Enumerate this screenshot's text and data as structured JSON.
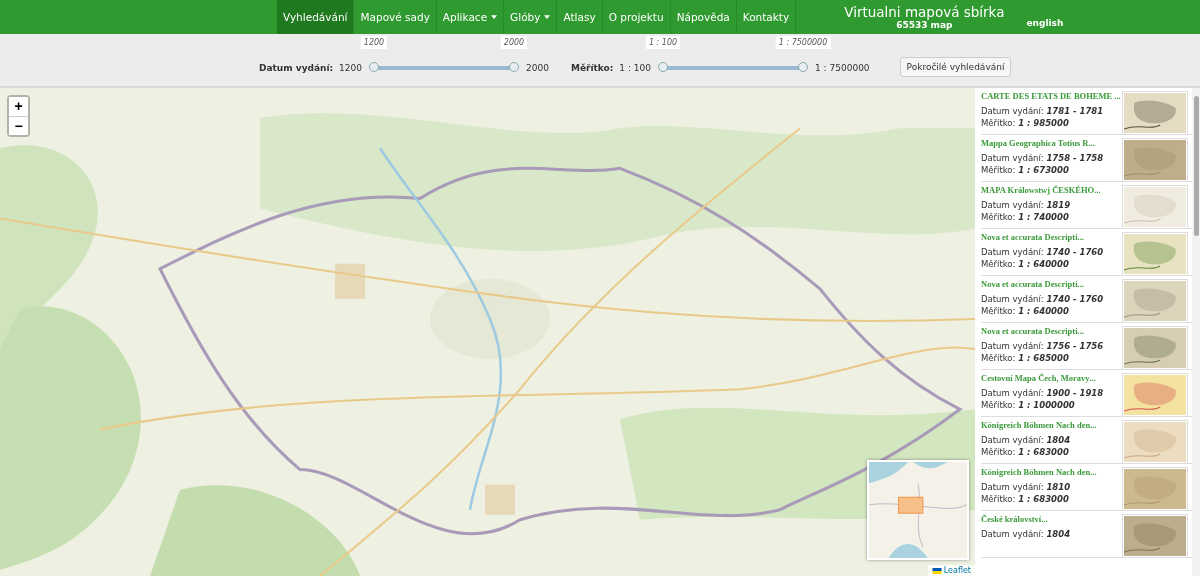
{
  "nav": {
    "items": [
      {
        "label": "Vyhledávání",
        "selected": true,
        "dropdown": false
      },
      {
        "label": "Mapové sady",
        "selected": false,
        "dropdown": false
      },
      {
        "label": "Aplikace",
        "selected": false,
        "dropdown": true
      },
      {
        "label": "Glóby",
        "selected": false,
        "dropdown": true
      },
      {
        "label": "Atlasy",
        "selected": false,
        "dropdown": false
      },
      {
        "label": "O projektu",
        "selected": false,
        "dropdown": false
      },
      {
        "label": "Nápověda",
        "selected": false,
        "dropdown": false
      },
      {
        "label": "Kontakty",
        "selected": false,
        "dropdown": false
      }
    ],
    "title": "Virtualni mapová sbírka",
    "count": "65533 map",
    "language": "english"
  },
  "filters": [
    {
      "label": "Datum vydání:",
      "min": "1200",
      "max": "2000",
      "thumbs": [
        {
          "tip": "1200",
          "level": 0
        },
        {
          "tip": "2000",
          "level": 1
        }
      ]
    },
    {
      "label": "Měřítko:",
      "min": "1 : 100",
      "max": "1 : 7500000",
      "thumbs": [
        {
          "tip": "1 : 100",
          "level": 0
        },
        {
          "tip": "1 : 7500000",
          "level": 1
        }
      ]
    }
  ],
  "advanced_button": "Pokročilé vyhledávání",
  "map": {
    "zoom_in": "+",
    "zoom_out": "−",
    "attribution": "Leaflet"
  },
  "results": {
    "items": [
      {
        "title": "CARTE DES ETATS DE BOHEME ...",
        "date_label": "Datum vydání:",
        "date": "1781 - 1781",
        "scale_label": "Měřítko:",
        "scale": "1 : 985000"
      },
      {
        "title": "Mappa Geographica Totius R...",
        "date_label": "Datum vydání:",
        "date": "1758 - 1758",
        "scale_label": "Měřítko:",
        "scale": "1 : 673000"
      },
      {
        "title": "MAPA Králowstwj ČESKÉHO...",
        "date_label": "Datum vydání:",
        "date": "1819",
        "scale_label": "Měřítko:",
        "scale": "1 : 740000"
      },
      {
        "title": "Nova et accurata Descripti...",
        "date_label": "Datum vydání:",
        "date": "1740 - 1760",
        "scale_label": "Měřítko:",
        "scale": "1 : 640000"
      },
      {
        "title": "Nova et accurata Descripti...",
        "date_label": "Datum vydání:",
        "date": "1740 - 1760",
        "scale_label": "Měřítko:",
        "scale": "1 : 640000"
      },
      {
        "title": "Nova et accurata Descripti...",
        "date_label": "Datum vydání:",
        "date": "1756 - 1756",
        "scale_label": "Měřítko:",
        "scale": "1 : 685000"
      },
      {
        "title": "Cestovní Mapa Čech, Moravy...",
        "date_label": "Datum vydání:",
        "date": "1900 - 1918",
        "scale_label": "Měřítko:",
        "scale": "1 : 1000000"
      },
      {
        "title": "Königreich Böhmen Nach den...",
        "date_label": "Datum vydání:",
        "date": "1804",
        "scale_label": "Měřítko:",
        "scale": "1 : 683000"
      },
      {
        "title": "Königreich Böhmen Nach den...",
        "date_label": "Datum vydání:",
        "date": "1810",
        "scale_label": "Měřítko:",
        "scale": "1 : 683000"
      },
      {
        "title": "České království...",
        "date_label": "Datum vydání:",
        "date": "1804"
      }
    ]
  }
}
